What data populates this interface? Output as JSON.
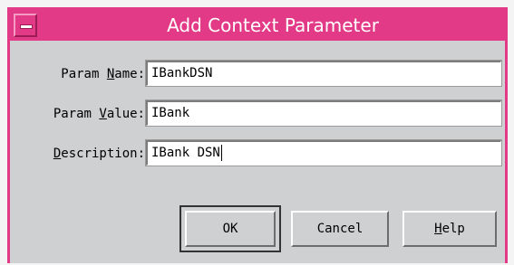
{
  "window": {
    "title": "Add Context Parameter"
  },
  "fields": [
    {
      "label_prefix": "Param ",
      "label_mnemonic": "N",
      "label_suffix": "ame:",
      "value": "IBankDSN"
    },
    {
      "label_prefix": "Param ",
      "label_mnemonic": "V",
      "label_suffix": "alue:",
      "value": "IBank"
    },
    {
      "label_prefix": "",
      "label_mnemonic": "D",
      "label_suffix": "escription:",
      "value": "IBank DSN"
    }
  ],
  "buttons": {
    "ok": "OK",
    "cancel": "Cancel",
    "help_mnemonic": "H",
    "help_rest": "elp"
  },
  "colors": {
    "titlebar": "#e23a86",
    "dialog_bg": "#cfd0d2"
  }
}
